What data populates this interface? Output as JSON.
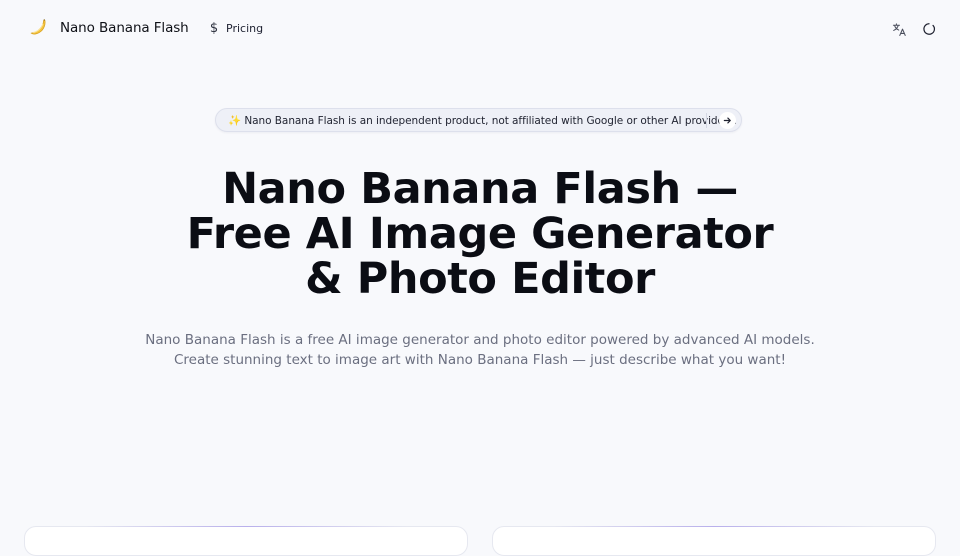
{
  "header": {
    "brand_name": "Nano Banana Flash",
    "logo_icon": "banana-icon",
    "nav": {
      "pricing_icon": "$",
      "pricing_label": "Pricing"
    },
    "icons": [
      "translate-icon",
      "theme-toggle-icon"
    ]
  },
  "notice": {
    "emoji": "✨",
    "text": "Nano Banana Flash is an independent product, not affiliated with Google or other AI providers.",
    "action_icon": "arrow-right-icon"
  },
  "hero": {
    "title_lines": [
      "Nano Banana Flash —",
      "Free AI Image Generator",
      "& Photo Editor"
    ],
    "subtitle_lines": [
      "Nano Banana Flash is a free AI image generator and photo editor powered by advanced AI models.",
      "Create stunning text to image art with Nano Banana Flash — just describe what you want!"
    ]
  },
  "colors": {
    "background": "#f8f9fc",
    "text": "#0b0d14",
    "muted": "#6b6f80",
    "banana": "#f5c542"
  }
}
